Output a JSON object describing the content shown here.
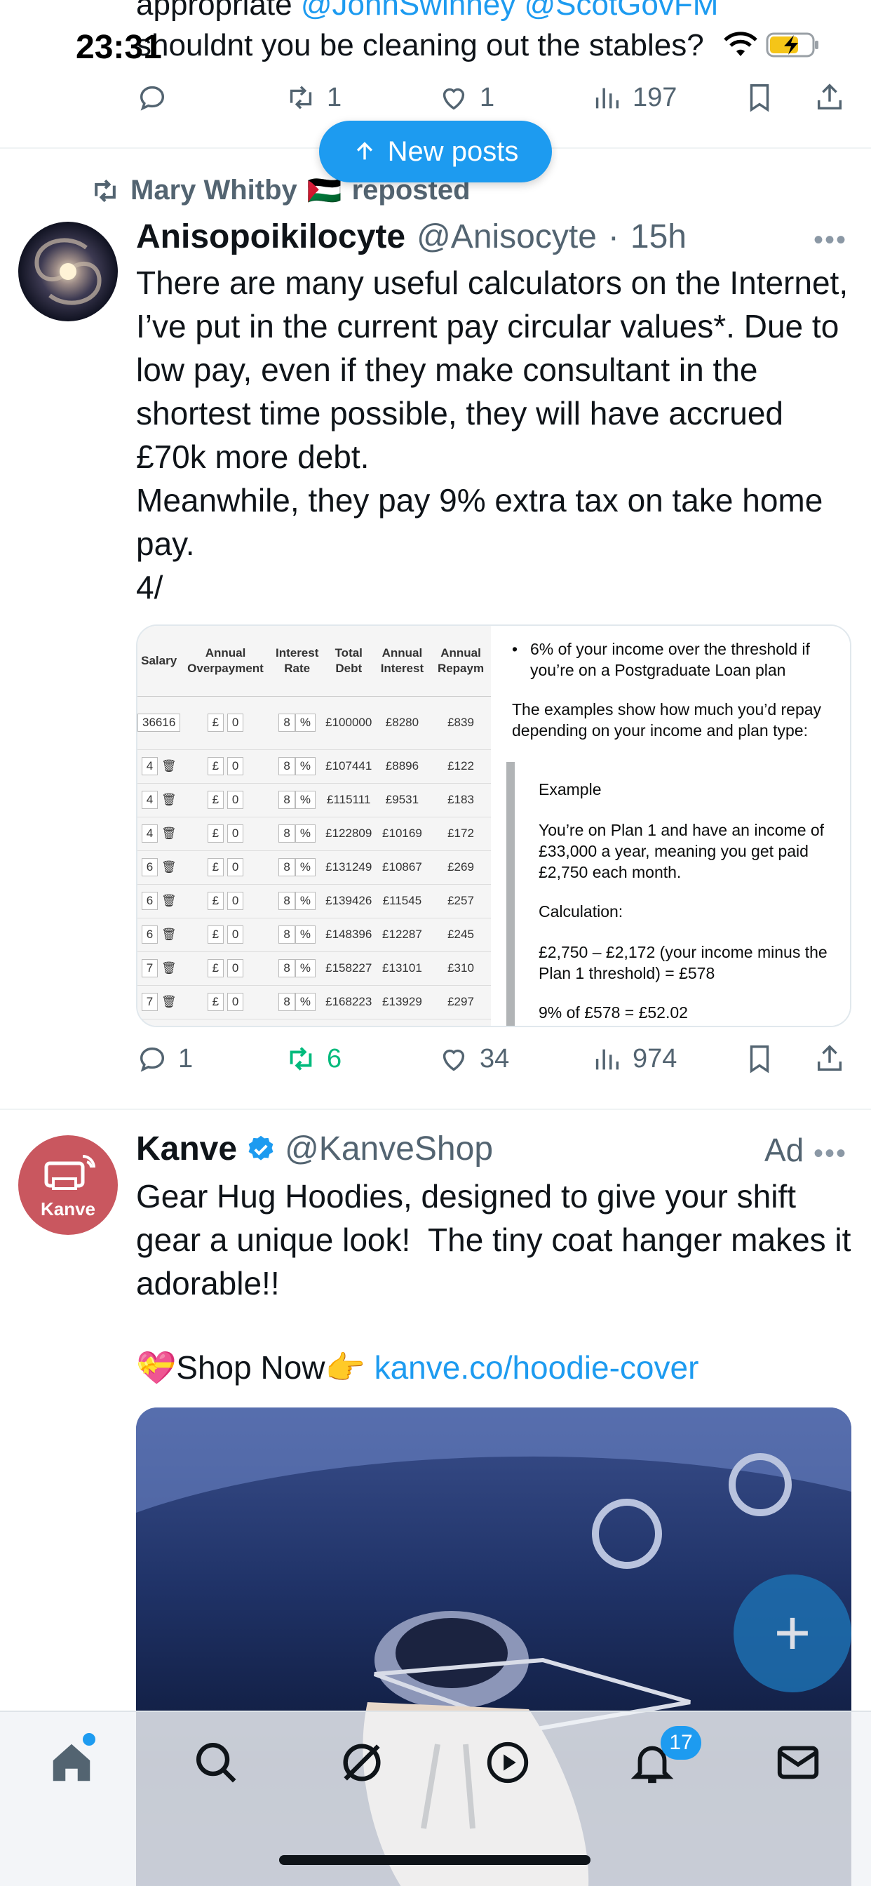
{
  "status_bar": {
    "time": "23:31"
  },
  "top_tweet": {
    "line1": "appropriate @JohnSwinney @ScotGovFM",
    "line2": "shouldnt you be cleaning  out the stables?",
    "actions": {
      "reposts": "1",
      "likes": "1",
      "views": "197"
    }
  },
  "new_posts_label": "New posts",
  "tweet1": {
    "repost_by": "Mary Whitby",
    "repost_flag": "🇵🇸",
    "repost_suffix": "reposted",
    "name": "Anisopoikilocyte",
    "handle": "@Anisocyte",
    "dot": "·",
    "time": "15h",
    "text": "There are many useful calculators on the Internet, I’ve put in the current pay circular values*. Due to low pay, even if they make consultant in the shortest time possible, they will have accrued £70k more debt.\nMeanwhile, they pay 9% extra tax on take home pay.\n4/",
    "actions": {
      "replies": "1",
      "reposts": "6",
      "likes": "34",
      "views": "974"
    },
    "media": {
      "table_headers": [
        "Salary",
        "Annual Overpayment",
        "Interest Rate",
        "Total Debt",
        "Annual Interest",
        "Annual Repaym"
      ],
      "first_row": {
        "salary": "36616",
        "overpay_prefix": "£",
        "overpay": "0",
        "rate": "8",
        "rate_unit": "%",
        "debt": "£100000",
        "interest": "£8280",
        "repay": "£839"
      },
      "rows": [
        {
          "salary": "4",
          "overpay": "0",
          "rate": "8",
          "debt": "£107441",
          "interest": "£8896",
          "repay": "£122"
        },
        {
          "salary": "4",
          "overpay": "0",
          "rate": "8",
          "debt": "£115111",
          "interest": "£9531",
          "repay": "£183"
        },
        {
          "salary": "4",
          "overpay": "0",
          "rate": "8",
          "debt": "£122809",
          "interest": "£10169",
          "repay": "£172"
        },
        {
          "salary": "6",
          "overpay": "0",
          "rate": "8",
          "debt": "£131249",
          "interest": "£10867",
          "repay": "£269"
        },
        {
          "salary": "6",
          "overpay": "0",
          "rate": "8",
          "debt": "£139426",
          "interest": "£11545",
          "repay": "£257"
        },
        {
          "salary": "6",
          "overpay": "0",
          "rate": "8",
          "debt": "£148396",
          "interest": "£12287",
          "repay": "£245"
        },
        {
          "salary": "7",
          "overpay": "0",
          "rate": "8",
          "debt": "£158227",
          "interest": "£13101",
          "repay": "£310"
        },
        {
          "salary": "7",
          "overpay": "0",
          "rate": "8",
          "debt": "£168223",
          "interest": "£13929",
          "repay": "£297"
        }
      ],
      "gov": {
        "bullet": "6% of your income over the threshold if you’re on a Postgraduate Loan plan",
        "examples": "The examples show how much you’d repay depending on your income and plan type:",
        "example_title": "Example",
        "example_body": "You’re on Plan 1 and have an income of £33,000 a year, meaning you get paid £2,750 each month.",
        "calc_title": "Calculation:",
        "calc_line": "£2,750 – £2,172 (your income minus the Plan 1 threshold) = £578",
        "calc_result": "9% of £578 = £52.02"
      }
    }
  },
  "ad_tweet": {
    "name": "Kanve",
    "handle": "@KanveShop",
    "ad_label": "Ad",
    "avatar_text": "Kanve",
    "text": "Gear Hug Hoodies, designed to give your shift gear a unique look!  The tiny coat hanger makes it adorable!!",
    "shop_emoji": "💝",
    "shop_label": "Shop Now",
    "shop_point": "👉",
    "shop_link": "kanve.co/hoodie-cover"
  },
  "fab_label": "+",
  "tabbar": {
    "notifications_count": "17"
  },
  "colors": {
    "accent": "#1d9bf0",
    "repost_green": "#00ba7c",
    "muted": "#536471"
  }
}
